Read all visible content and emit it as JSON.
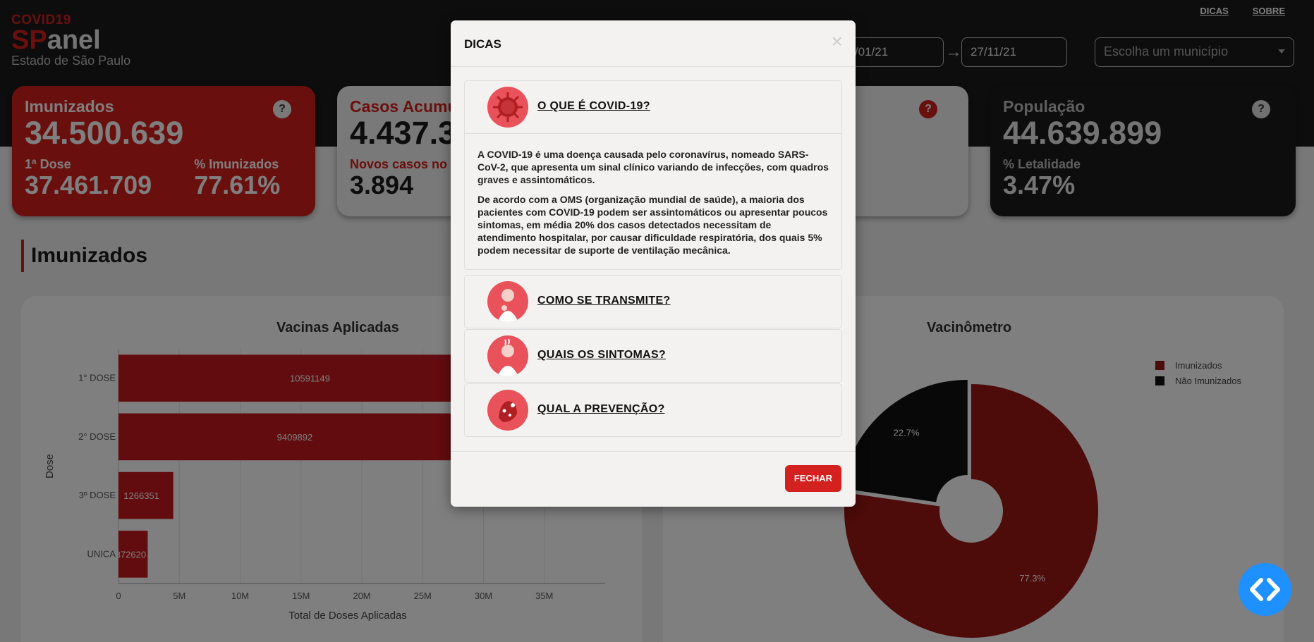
{
  "brand": {
    "covid": "COVID19",
    "sp": "SP",
    "anel": "anel",
    "estado": "Estado de São Paulo"
  },
  "nav": {
    "dicas": "DICAS",
    "sobre": "SOBRE"
  },
  "filters": {
    "date_start": "01/01/21",
    "date_end": "27/11/21",
    "municipio_placeholder": "Escolha um município"
  },
  "cards": {
    "imunizados": {
      "title": "Imunizados",
      "value": "34.500.639",
      "dose1_label": "1ª Dose",
      "dose1_value": "37.461.709",
      "pct_label": "% Imunizados",
      "pct_value": "77.61%"
    },
    "casos": {
      "title": "Casos Acumu",
      "value": "4.437.3",
      "novos_label": "Novos casos no",
      "novos_value": "3.894"
    },
    "populacao": {
      "title": "População",
      "value": "44.639.899",
      "letal_label": "% Letalidade",
      "letal_value": "3.47%"
    },
    "help": "?"
  },
  "section": {
    "title": "Imunizados"
  },
  "vacinas_chart": {
    "title": "Vacinas Aplicadas",
    "chart_data": {
      "type": "bar",
      "orientation": "horizontal",
      "title": "Vacinas Aplicadas",
      "ylabel": "Dose",
      "xlabel": "Total de Doses Aplicadas",
      "categories": [
        "1° DOSE",
        "2° DOSE",
        "3º DOSE",
        "UNICA"
      ],
      "values": [
        37461709,
        34500639,
        4500000,
        2400000
      ],
      "data_labels": [
        "10591149",
        "9409892",
        "1266351",
        "372620"
      ],
      "xticks": [
        "0",
        "5M",
        "10M",
        "15M",
        "20M",
        "25M",
        "30M",
        "35M"
      ],
      "xlim": [
        0,
        40000000
      ]
    }
  },
  "vacinometro": {
    "title": "Vacinômetro",
    "chart_data": {
      "type": "pie",
      "title": "Vacinômetro",
      "labels": [
        "Imunizados",
        "Não Imunizados"
      ],
      "values": [
        77.3,
        22.7
      ],
      "value_labels": [
        "77.3%",
        "22.7%"
      ],
      "legend": "top-right",
      "colors": [
        "#9a1713",
        "#111111"
      ]
    }
  },
  "modal": {
    "title": "DICAS",
    "close": "×",
    "sections": [
      {
        "label": "O QUE É COVID-19?",
        "icon": "virus-icon",
        "paragraphs": [
          "A COVID-19 é uma doença causada pelo coronavírus, nomeado SARS-CoV-2, que apresenta um sinal clínico variando de infecções, com quadros graves e assintomáticos.",
          "De acordo com a OMS (organização mundial de saúde), a maioria dos pacientes com COVID-19 podem ser assintomáticos ou apresentar poucos sintomas, em média 20% dos casos detectados necessitam de atendimento hospitalar, por causar dificuldade respiratória, dos quais 5% podem necessitar de suporte de ventilação mecânica."
        ]
      },
      {
        "label": "COMO SE TRANSMITE?",
        "icon": "person-coughing-icon"
      },
      {
        "label": "QUAIS OS SINTOMAS?",
        "icon": "person-fever-icon"
      },
      {
        "label": "QUAL A PREVENÇÃO?",
        "icon": "hand-washing-icon"
      }
    ],
    "button": "FECHAR"
  },
  "fab": {
    "icon": "code-icon"
  }
}
